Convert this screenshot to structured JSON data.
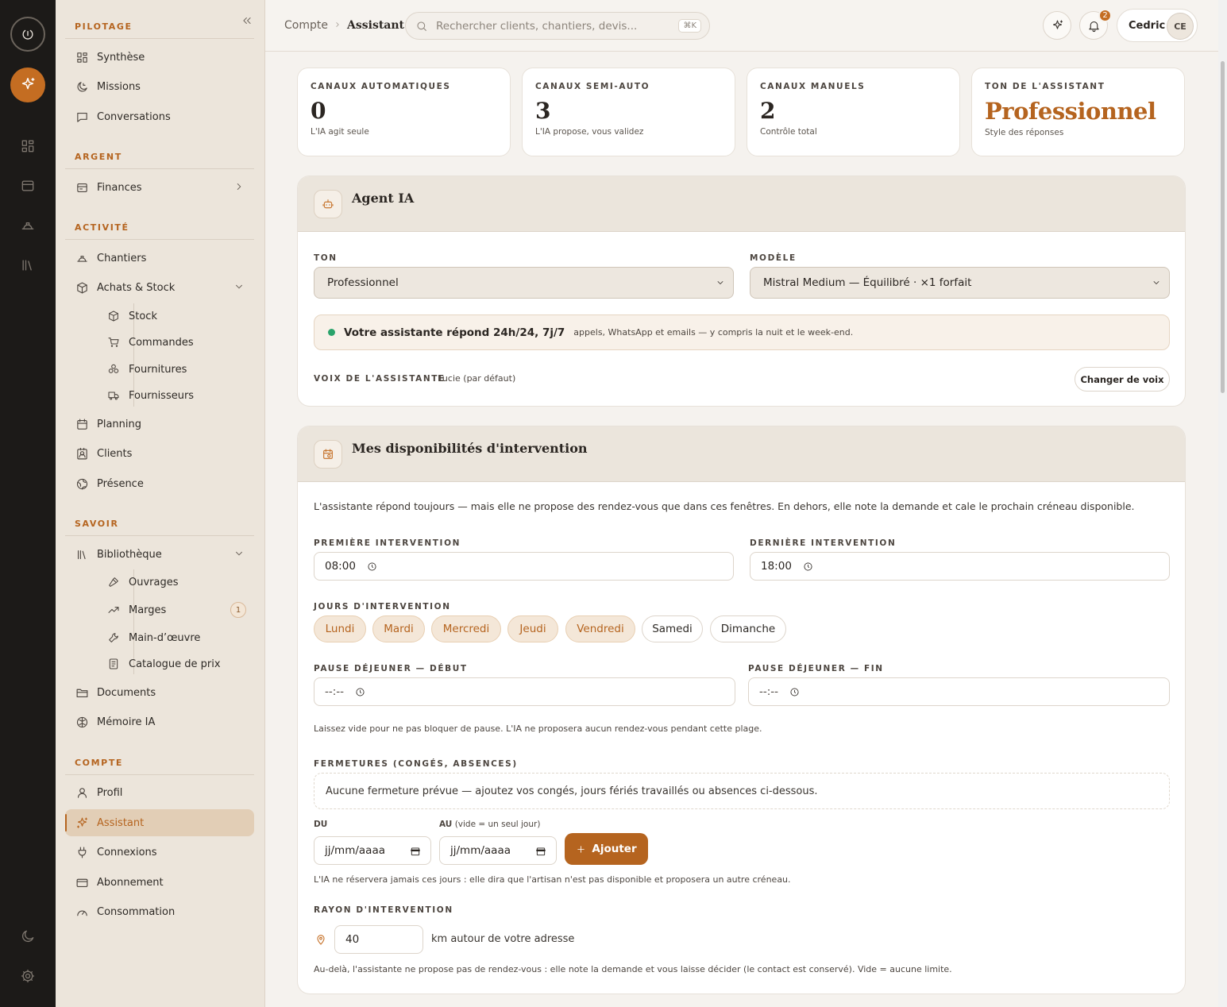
{
  "sidebar": {
    "sections": {
      "pilotage": "PILOTAGE",
      "argent": "ARGENT",
      "activite": "ACTIVITÉ",
      "savoir": "SAVOIR",
      "compte": "COMPTE"
    },
    "items": {
      "synthese": "Synthèse",
      "missions": "Missions",
      "conversations": "Conversations",
      "finances": "Finances",
      "chantiers": "Chantiers",
      "achats": "Achats & Stock",
      "stock": "Stock",
      "commandes": "Commandes",
      "fournitures": "Fournitures",
      "fournisseurs": "Fournisseurs",
      "planning": "Planning",
      "clients": "Clients",
      "presence": "Présence",
      "bibliotheque": "Bibliothèque",
      "ouvrages": "Ouvrages",
      "marges": "Marges",
      "marges_badge": "1",
      "main_oeuvre": "Main-d’œuvre",
      "catalogue": "Catalogue de prix",
      "documents": "Documents",
      "memoire": "Mémoire IA",
      "profil": "Profil",
      "assistant": "Assistant",
      "connexions": "Connexions",
      "abonnement": "Abonnement",
      "consommation": "Consommation"
    },
    "active": "Assistant"
  },
  "topbar": {
    "crumb_parent": "Compte",
    "crumb_current": "Assistant",
    "search_placeholder": "Rechercher clients, chantiers, devis...",
    "search_shortcut": "⌘K",
    "notifications_count": "2",
    "user_name": "Cedric",
    "user_initials": "CE"
  },
  "stats": [
    {
      "title": "CANAUX AUTOMATIQUES",
      "value": "0",
      "desc": "L'IA agit seule"
    },
    {
      "title": "CANAUX SEMI-AUTO",
      "value": "3",
      "desc": "L'IA propose, vous validez"
    },
    {
      "title": "CANAUX MANUELS",
      "value": "2",
      "desc": "Contrôle total"
    },
    {
      "title": "TON DE L'ASSISTANT",
      "value": "Professionnel",
      "desc": "Style des réponses"
    }
  ],
  "agent": {
    "title": "Agent IA",
    "ton_label": "TON",
    "ton_value": "Professionnel",
    "modele_label": "MODÈLE",
    "modele_value": "Mistral Medium — Équilibré · ×1 forfait",
    "status_strong": "Votre assistante répond 24h/24, 7j/7",
    "status_rest": "appels, WhatsApp et emails — y compris la nuit et le week-end.",
    "voice_label": "VOIX DE L'ASSISTANTE",
    "voice_value": "Lucie (par défaut)",
    "voice_button": "Changer de voix"
  },
  "dispo": {
    "title": "Mes disponibilités d'intervention",
    "intro": "L'assistante répond toujours — mais elle ne propose des rendez-vous que dans ces fenêtres. En dehors, elle note la demande et cale le prochain créneau disponible.",
    "first_label": "PREMIÈRE INTERVENTION",
    "first_value": "08:00",
    "last_label": "DERNIÈRE INTERVENTION",
    "last_value": "18:00",
    "days_label": "JOURS D'INTERVENTION",
    "days": [
      {
        "label": "Lundi",
        "selected": true
      },
      {
        "label": "Mardi",
        "selected": true
      },
      {
        "label": "Mercredi",
        "selected": true
      },
      {
        "label": "Jeudi",
        "selected": true
      },
      {
        "label": "Vendredi",
        "selected": true
      },
      {
        "label": "Samedi",
        "selected": false
      },
      {
        "label": "Dimanche",
        "selected": false
      }
    ],
    "pause_start_label": "PAUSE DÉJEUNER — DÉBUT",
    "pause_start_value": "--:--",
    "pause_end_label": "PAUSE DÉJEUNER — FIN",
    "pause_end_value": "--:--",
    "pause_hint": "Laissez vide pour ne pas bloquer de pause. L'IA ne proposera aucun rendez-vous pendant cette plage.",
    "closures_label": "FERMETURES (CONGÉS, ABSENCES)",
    "closures_empty": "Aucune fermeture prévue — ajoutez vos congés, jours fériés travaillés ou absences ci-dessous.",
    "du_label": "DU",
    "au_label": "AU",
    "au_hint": "(vide = un seul jour)",
    "date_placeholder": "jj/mm/aaaa",
    "add_button": "Ajouter",
    "closures_hint": "L'IA ne réservera jamais ces jours : elle dira que l'artisan n'est pas disponible et proposera un autre créneau.",
    "radius_label": "RAYON D'INTERVENTION",
    "radius_value": "40",
    "radius_unit": "km autour de votre adresse",
    "radius_hint": "Au-delà, l'assistante ne propose pas de rendez-vous : elle note la demande et vous laisse décider (le contact est conservé). Vide = aucune limite."
  },
  "colors": {
    "accent": "#b5641f",
    "rail": "#1c1a18",
    "sidebar": "#ece5db",
    "success": "#2aa36b"
  }
}
